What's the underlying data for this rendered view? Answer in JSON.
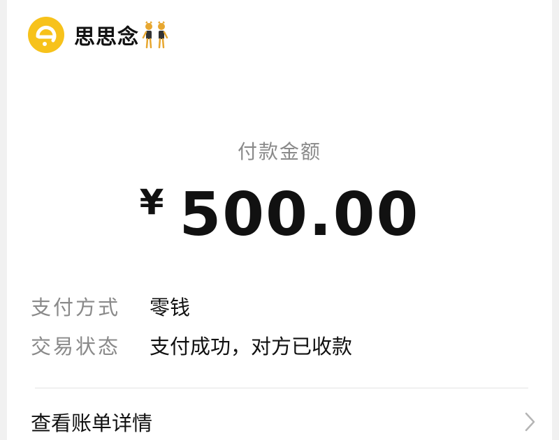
{
  "header": {
    "merchant_name": "思思念",
    "avatar_icon": "smile-logo-icon",
    "emoji_icon": "dancing-women-emoji-icon",
    "brand_color": "#f7c21b"
  },
  "payment": {
    "label": "付款金额",
    "currency": "¥",
    "amount": "500.00"
  },
  "details": [
    {
      "label": "支付方式",
      "value": "零钱"
    },
    {
      "label": "交易状态",
      "value": "支付成功，对方已收款"
    }
  ],
  "footer": {
    "bill_link_label": "查看账单详情",
    "chevron_icon": "chevron-right-icon"
  }
}
